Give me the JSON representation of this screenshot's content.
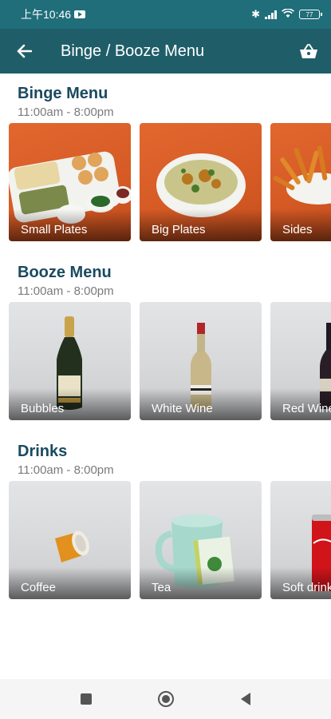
{
  "status_bar": {
    "time": "上午10:46",
    "battery": "77",
    "icons": [
      "youtube-icon",
      "bluetooth-icon",
      "signal-icon",
      "wifi-icon",
      "battery-icon"
    ]
  },
  "app_bar": {
    "title": "Binge / Booze Menu",
    "back_icon": "arrow-left-icon",
    "cart_icon": "basket-icon"
  },
  "sections": [
    {
      "title": "Binge Menu",
      "hours": "11:00am - 8:00pm",
      "items": [
        {
          "label": "Small Plates"
        },
        {
          "label": "Big Plates"
        },
        {
          "label": "Sides"
        }
      ]
    },
    {
      "title": "Booze Menu",
      "hours": "11:00am - 8:00pm",
      "items": [
        {
          "label": "Bubbles"
        },
        {
          "label": "White Wine"
        },
        {
          "label": "Red Wine"
        }
      ]
    },
    {
      "title": "Drinks",
      "hours": "11:00am - 8:00pm",
      "items": [
        {
          "label": "Coffee"
        },
        {
          "label": "Tea"
        },
        {
          "label": "Soft drinks"
        }
      ]
    }
  ],
  "nav_bar": {
    "icons": [
      "recents-square-icon",
      "home-circle-icon",
      "back-triangle-icon"
    ]
  },
  "colors": {
    "status_bar": "#1f6e7a",
    "app_bar": "#1f5e69",
    "section_title": "#1a4a60",
    "food_card_bg": "#d55a24",
    "drink_card_bg": "#d7d8da"
  }
}
